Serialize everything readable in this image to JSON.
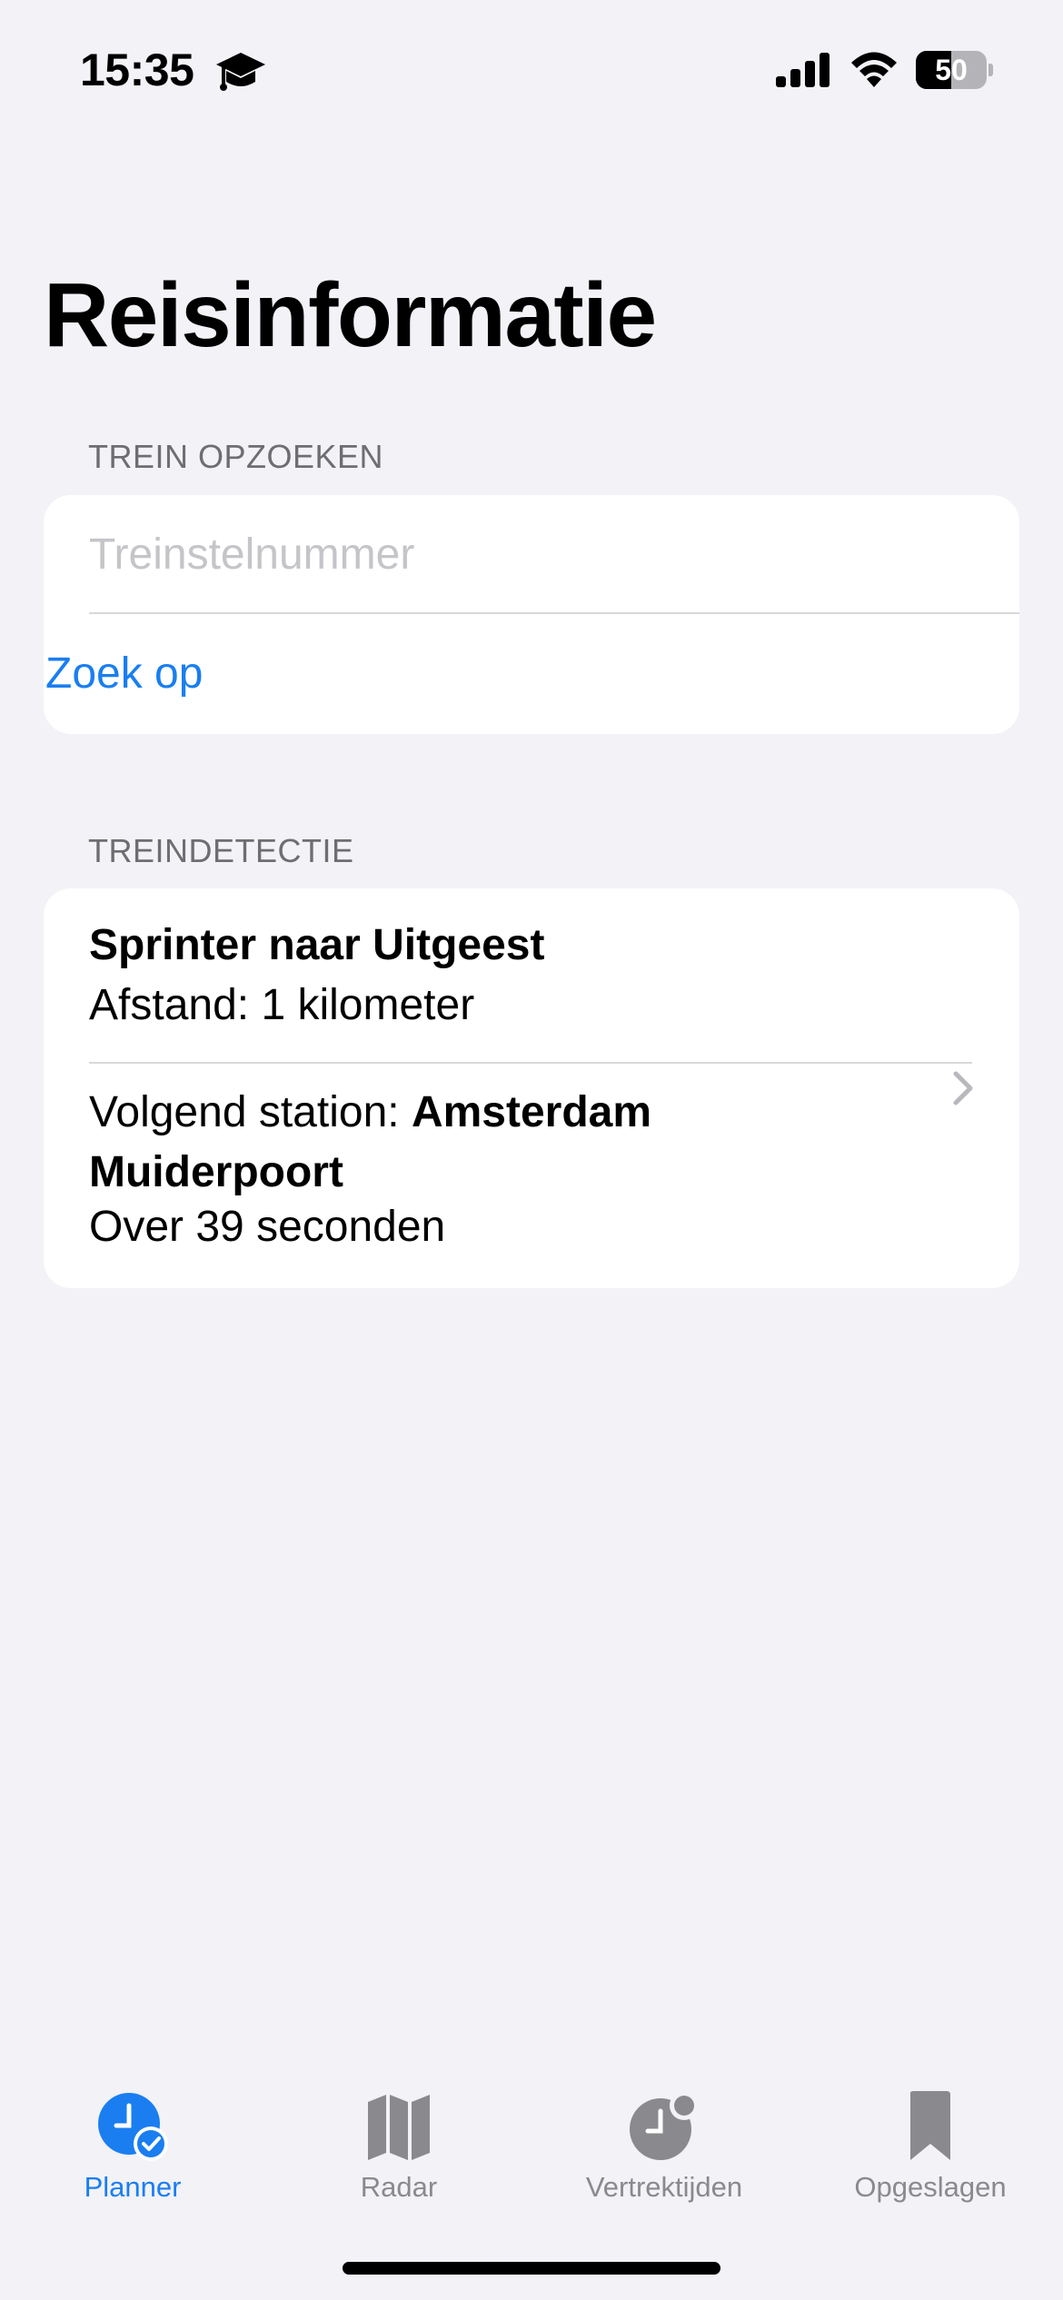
{
  "status_bar": {
    "time": "15:35",
    "battery_percent": "50",
    "battery_level": 0.5,
    "icons": [
      "graduation-cap-icon",
      "cellular-signal-icon",
      "wifi-icon",
      "battery-icon"
    ]
  },
  "page": {
    "title": "Reisinformatie"
  },
  "search_section": {
    "header": "TREIN OPZOEKEN",
    "input_placeholder": "Treinstelnummer",
    "input_value": "",
    "button_label": "Zoek op"
  },
  "detection_section": {
    "header": "TREINDETECTIE",
    "train_title": "Sprinter naar Uitgeest",
    "distance": "Afstand: 1 kilometer",
    "next_station_prefix": "Volgend station: ",
    "next_station_name": "Amsterdam Muiderpoort",
    "eta": "Over 39 seconden",
    "icon": "chevron-right-icon"
  },
  "tab_bar": {
    "tabs": [
      {
        "label": "Planner",
        "icon": "planner-clock-check-icon",
        "active": true
      },
      {
        "label": "Radar",
        "icon": "map-icon",
        "active": false
      },
      {
        "label": "Vertrektijden",
        "icon": "clock-badge-icon",
        "active": false
      },
      {
        "label": "Opgeslagen",
        "icon": "bookmark-icon",
        "active": false
      }
    ]
  },
  "colors": {
    "accent": "#1a7ef0",
    "background": "#f2f2f7",
    "card": "#ffffff",
    "inactive_tab": "#8a8a8e"
  }
}
